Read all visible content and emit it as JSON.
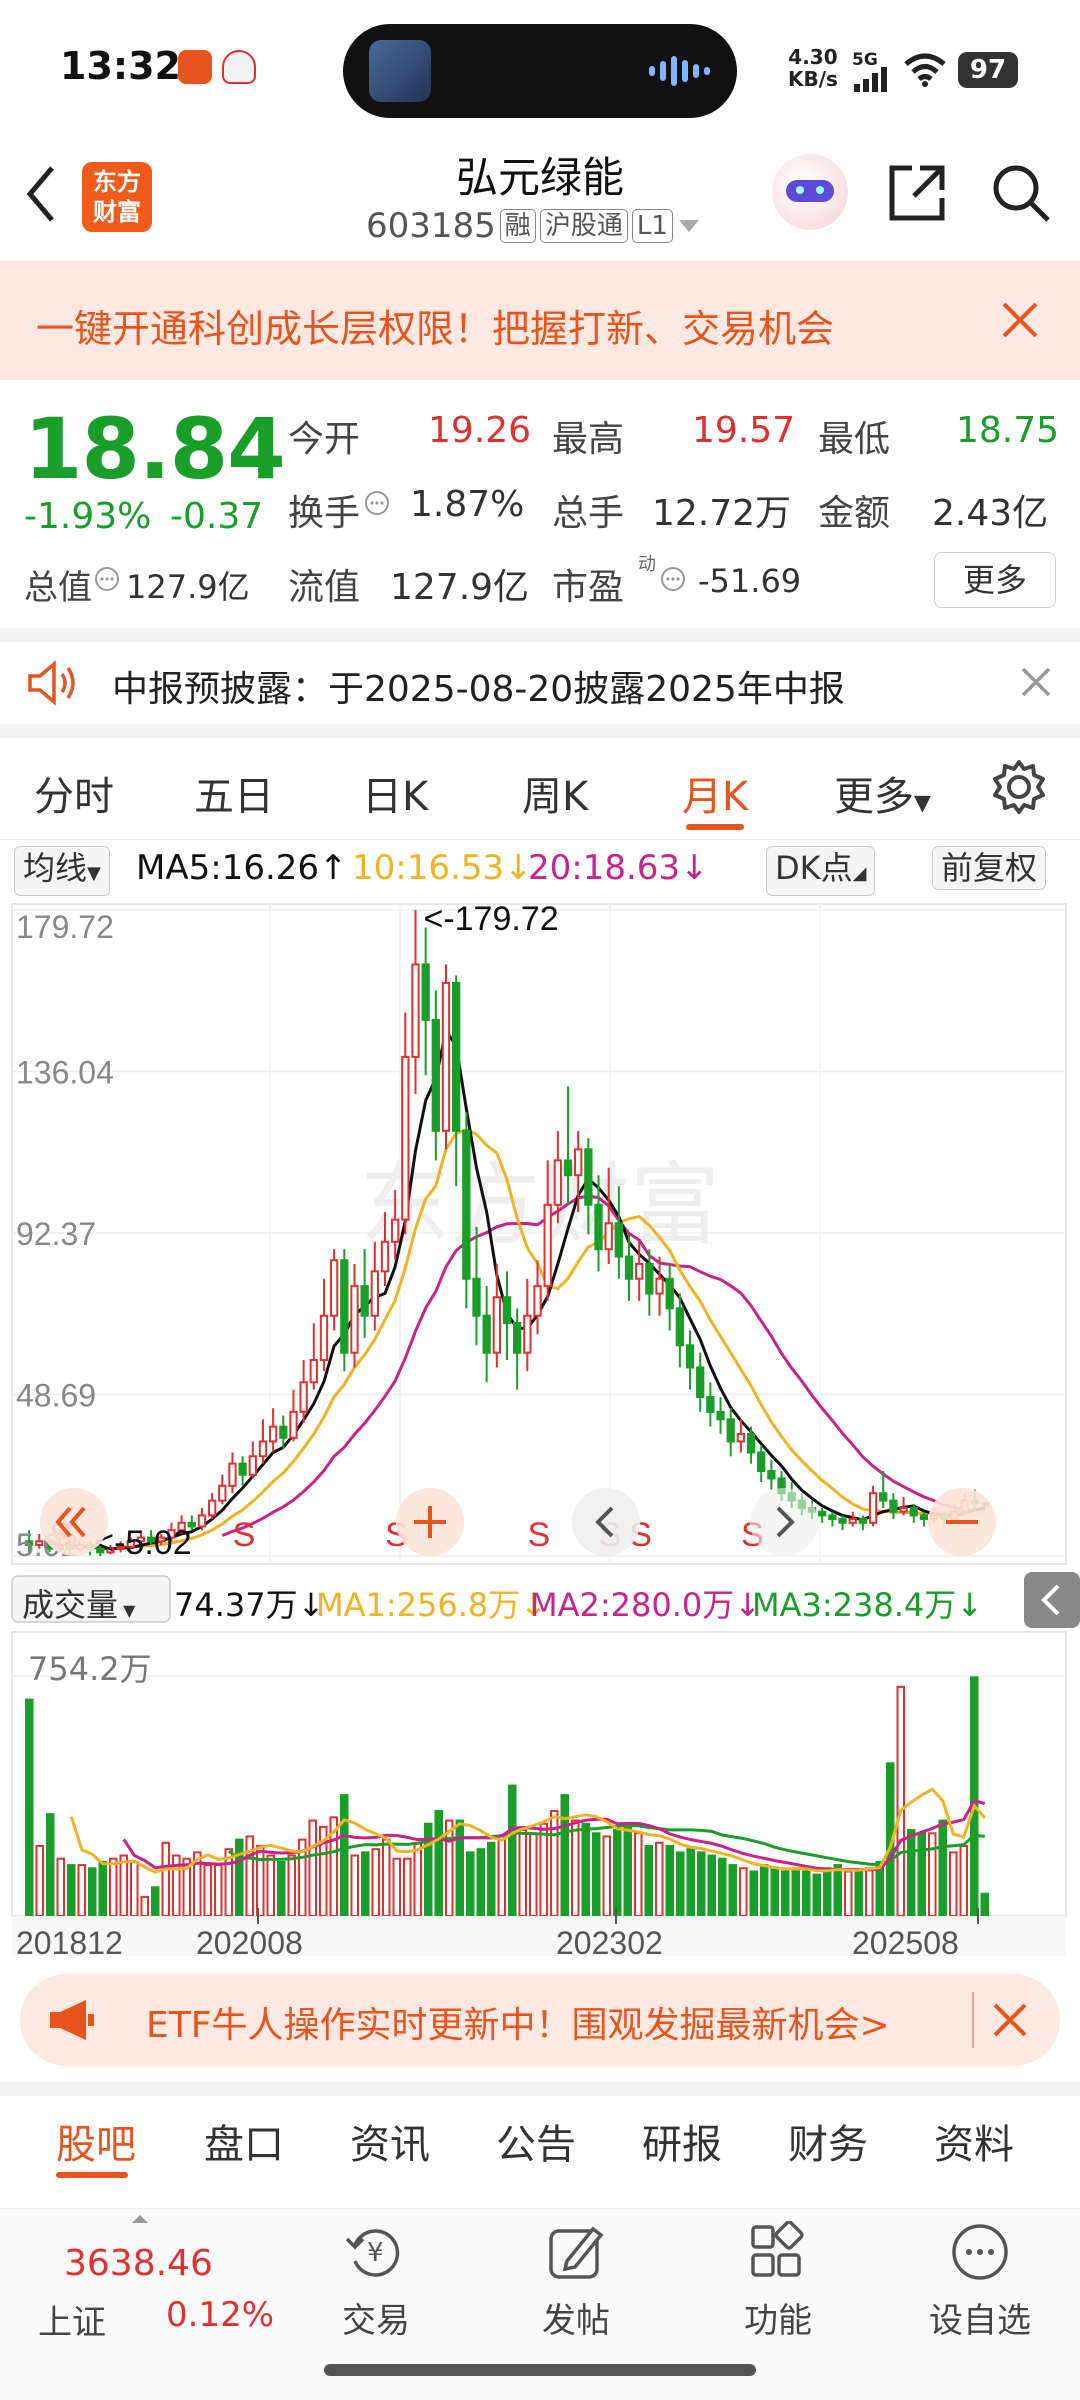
{
  "status_bar": {
    "time": "13:32",
    "net_speed_value": "4.30",
    "net_speed_unit": "KB/s",
    "network": "5G",
    "battery": "97"
  },
  "header": {
    "logo_line1": "东方",
    "logo_line2": "财富",
    "stock_name": "弘元绿能",
    "stock_code": "603185",
    "tags": [
      "融",
      "沪股通",
      "L1"
    ]
  },
  "banner": {
    "text": "一键开通科创成长层权限！把握打新、交易机会"
  },
  "quote": {
    "price": "18.84",
    "change_pct": "-1.93%",
    "change": "-0.37",
    "open_label": "今开",
    "open": "19.26",
    "high_label": "最高",
    "high": "19.57",
    "low_label": "最低",
    "low": "18.75",
    "turnover_label": "换手",
    "turnover": "1.87%",
    "volume_label": "总手",
    "volume": "12.72万",
    "amount_label": "金额",
    "amount": "2.43亿",
    "mktcap_label": "总值",
    "mktcap": "127.9亿",
    "float_label": "流值",
    "float": "127.9亿",
    "pe_label": "市盈",
    "pe_sup": "动",
    "pe": "-51.69",
    "more_label": "更多"
  },
  "notice": {
    "text": "中报预披露：于2025-08-20披露2025年中报"
  },
  "kline_tabs": [
    "分时",
    "五日",
    "日K",
    "周K",
    "月K",
    "更多"
  ],
  "kline_active": "月K",
  "ma_row": {
    "selector": "均线",
    "ma5": "MA5:16.26",
    "ma5_arrow": "↑",
    "ma10": "10:16.53",
    "ma10_arrow": "↓",
    "ma20": "20:18.63",
    "ma20_arrow": "↓",
    "dk_label": "DK点",
    "adjust_label": "前复权"
  },
  "chart_data": {
    "type": "candlestick",
    "period": "monthly",
    "y_ticks": [
      "179.72",
      "136.04",
      "92.37",
      "48.69",
      "5.02"
    ],
    "ylim": [
      5.02,
      179.72
    ],
    "max_annotation": "<-179.72",
    "min_annotation": "<-5.02",
    "x_ticks": [
      "201812",
      "202008",
      "202302",
      "202508"
    ],
    "signal_marker": "S",
    "candles": [
      {
        "o": 9,
        "c": 8,
        "h": 12,
        "l": 6
      },
      {
        "o": 8,
        "c": 9,
        "h": 11,
        "l": 7
      },
      {
        "o": 9,
        "c": 7,
        "h": 10,
        "l": 6
      },
      {
        "o": 7,
        "c": 8,
        "h": 10,
        "l": 6
      },
      {
        "o": 8,
        "c": 7,
        "h": 9,
        "l": 5.5
      },
      {
        "o": 7,
        "c": 8,
        "h": 9,
        "l": 6
      },
      {
        "o": 8,
        "c": 7,
        "h": 9,
        "l": 5.2
      },
      {
        "o": 7,
        "c": 6,
        "h": 8,
        "l": 5.02
      },
      {
        "o": 6,
        "c": 7,
        "h": 8,
        "l": 5.5
      },
      {
        "o": 7,
        "c": 7.5,
        "h": 9,
        "l": 6
      },
      {
        "o": 7.5,
        "c": 9,
        "h": 10,
        "l": 7
      },
      {
        "o": 9,
        "c": 10,
        "h": 12,
        "l": 8
      },
      {
        "o": 10,
        "c": 9,
        "h": 12,
        "l": 8
      },
      {
        "o": 9,
        "c": 10,
        "h": 11,
        "l": 8
      },
      {
        "o": 10,
        "c": 12,
        "h": 14,
        "l": 9
      },
      {
        "o": 12,
        "c": 14,
        "h": 16,
        "l": 11
      },
      {
        "o": 14,
        "c": 13,
        "h": 16,
        "l": 12
      },
      {
        "o": 13,
        "c": 16,
        "h": 18,
        "l": 12
      },
      {
        "o": 16,
        "c": 20,
        "h": 22,
        "l": 15
      },
      {
        "o": 20,
        "c": 24,
        "h": 27,
        "l": 19
      },
      {
        "o": 24,
        "c": 30,
        "h": 33,
        "l": 22
      },
      {
        "o": 30,
        "c": 27,
        "h": 32,
        "l": 24
      },
      {
        "o": 27,
        "c": 32,
        "h": 36,
        "l": 26
      },
      {
        "o": 32,
        "c": 36,
        "h": 42,
        "l": 30
      },
      {
        "o": 36,
        "c": 40,
        "h": 45,
        "l": 33
      },
      {
        "o": 40,
        "c": 37,
        "h": 43,
        "l": 34
      },
      {
        "o": 37,
        "c": 44,
        "h": 50,
        "l": 36
      },
      {
        "o": 44,
        "c": 52,
        "h": 58,
        "l": 41
      },
      {
        "o": 52,
        "c": 58,
        "h": 68,
        "l": 50
      },
      {
        "o": 58,
        "c": 70,
        "h": 80,
        "l": 55
      },
      {
        "o": 70,
        "c": 85,
        "h": 88,
        "l": 66
      },
      {
        "o": 85,
        "c": 60,
        "h": 88,
        "l": 55
      },
      {
        "o": 60,
        "c": 78,
        "h": 84,
        "l": 56
      },
      {
        "o": 78,
        "c": 70,
        "h": 88,
        "l": 64
      },
      {
        "o": 70,
        "c": 82,
        "h": 90,
        "l": 66
      },
      {
        "o": 82,
        "c": 90,
        "h": 98,
        "l": 78
      },
      {
        "o": 90,
        "c": 96,
        "h": 104,
        "l": 85
      },
      {
        "o": 96,
        "c": 140,
        "h": 152,
        "l": 92
      },
      {
        "o": 140,
        "c": 165,
        "h": 179.72,
        "l": 130
      },
      {
        "o": 165,
        "c": 150,
        "h": 175,
        "l": 135
      },
      {
        "o": 150,
        "c": 120,
        "h": 158,
        "l": 112
      },
      {
        "o": 120,
        "c": 160,
        "h": 165,
        "l": 115
      },
      {
        "o": 160,
        "c": 120,
        "h": 162,
        "l": 105
      },
      {
        "o": 120,
        "c": 80,
        "h": 125,
        "l": 72
      },
      {
        "o": 80,
        "c": 70,
        "h": 94,
        "l": 62
      },
      {
        "o": 70,
        "c": 60,
        "h": 78,
        "l": 52
      },
      {
        "o": 60,
        "c": 75,
        "h": 84,
        "l": 56
      },
      {
        "o": 75,
        "c": 68,
        "h": 82,
        "l": 58
      },
      {
        "o": 68,
        "c": 60,
        "h": 72,
        "l": 50
      },
      {
        "o": 60,
        "c": 70,
        "h": 80,
        "l": 55
      },
      {
        "o": 70,
        "c": 78,
        "h": 85,
        "l": 65
      },
      {
        "o": 78,
        "c": 100,
        "h": 112,
        "l": 74
      },
      {
        "o": 100,
        "c": 112,
        "h": 120,
        "l": 95
      },
      {
        "o": 112,
        "c": 108,
        "h": 132,
        "l": 100
      },
      {
        "o": 108,
        "c": 115,
        "h": 120,
        "l": 98
      },
      {
        "o": 115,
        "c": 100,
        "h": 118,
        "l": 92
      },
      {
        "o": 100,
        "c": 88,
        "h": 108,
        "l": 82
      },
      {
        "o": 88,
        "c": 95,
        "h": 110,
        "l": 84
      },
      {
        "o": 95,
        "c": 86,
        "h": 105,
        "l": 80
      },
      {
        "o": 86,
        "c": 80,
        "h": 92,
        "l": 74
      },
      {
        "o": 80,
        "c": 84,
        "h": 90,
        "l": 74
      },
      {
        "o": 84,
        "c": 76,
        "h": 88,
        "l": 70
      },
      {
        "o": 76,
        "c": 80,
        "h": 86,
        "l": 70
      },
      {
        "o": 80,
        "c": 72,
        "h": 84,
        "l": 66
      },
      {
        "o": 72,
        "c": 62,
        "h": 76,
        "l": 56
      },
      {
        "o": 62,
        "c": 56,
        "h": 66,
        "l": 50
      },
      {
        "o": 56,
        "c": 48,
        "h": 60,
        "l": 44
      },
      {
        "o": 48,
        "c": 44,
        "h": 52,
        "l": 40
      },
      {
        "o": 44,
        "c": 42,
        "h": 48,
        "l": 38
      },
      {
        "o": 42,
        "c": 36,
        "h": 45,
        "l": 32
      },
      {
        "o": 36,
        "c": 38,
        "h": 42,
        "l": 33
      },
      {
        "o": 38,
        "c": 33,
        "h": 40,
        "l": 30
      },
      {
        "o": 33,
        "c": 28,
        "h": 35,
        "l": 25
      },
      {
        "o": 28,
        "c": 26,
        "h": 31,
        "l": 23
      },
      {
        "o": 26,
        "c": 22,
        "h": 28,
        "l": 20
      },
      {
        "o": 22,
        "c": 20,
        "h": 25,
        "l": 18
      },
      {
        "o": 20,
        "c": 18,
        "h": 22,
        "l": 16
      },
      {
        "o": 18,
        "c": 17,
        "h": 20,
        "l": 15
      },
      {
        "o": 17,
        "c": 16,
        "h": 18,
        "l": 14
      },
      {
        "o": 16,
        "c": 15,
        "h": 17,
        "l": 13
      },
      {
        "o": 15,
        "c": 14,
        "h": 16,
        "l": 12
      },
      {
        "o": 14,
        "c": 15,
        "h": 17,
        "l": 13
      },
      {
        "o": 15,
        "c": 14,
        "h": 16,
        "l": 12
      },
      {
        "o": 14,
        "c": 22,
        "h": 24,
        "l": 13
      },
      {
        "o": 22,
        "c": 20,
        "h": 28,
        "l": 18
      },
      {
        "o": 20,
        "c": 17,
        "h": 22,
        "l": 15
      },
      {
        "o": 17,
        "c": 18,
        "h": 21,
        "l": 16
      },
      {
        "o": 18,
        "c": 16,
        "h": 19,
        "l": 14
      },
      {
        "o": 16,
        "c": 15,
        "h": 17,
        "l": 13
      },
      {
        "o": 15,
        "c": 16,
        "h": 18,
        "l": 14
      },
      {
        "o": 16,
        "c": 15,
        "h": 17,
        "l": 13
      },
      {
        "o": 15,
        "c": 17,
        "h": 19,
        "l": 14
      },
      {
        "o": 17,
        "c": 20,
        "h": 22,
        "l": 16
      },
      {
        "o": 20,
        "c": 19.26,
        "h": 23,
        "l": 17
      },
      {
        "o": 19.26,
        "c": 18.84,
        "h": 19.57,
        "l": 18.75
      }
    ],
    "signals": [
      3,
      21,
      36,
      50,
      57,
      60,
      71
    ]
  },
  "volume_row": {
    "selector": "成交量",
    "vol": "74.37万",
    "vol_arrow": "↓",
    "ma1": "MA1:256.8万",
    "ma1_arrow": "↓",
    "ma2": "MA2:280.0万",
    "ma2_arrow": "↓",
    "ma3": "MA3:238.4万",
    "ma3_arrow": "↓",
    "max_label": "754.2万"
  },
  "volume_data": {
    "ylim": [
      0,
      754.2
    ],
    "values": [
      680,
      220,
      320,
      180,
      160,
      160,
      150,
      170,
      180,
      190,
      170,
      60,
      90,
      230,
      190,
      180,
      200,
      160,
      160,
      210,
      240,
      250,
      220,
      190,
      170,
      190,
      240,
      300,
      280,
      310,
      380,
      190,
      200,
      210,
      240,
      180,
      180,
      230,
      290,
      330,
      300,
      300,
      200,
      210,
      230,
      250,
      410,
      270,
      260,
      290,
      330,
      380,
      300,
      290,
      260,
      250,
      270,
      280,
      260,
      220,
      230,
      220,
      200,
      210,
      200,
      190,
      180,
      160,
      150,
      140,
      160,
      150,
      140,
      150,
      140,
      130,
      150,
      160,
      140,
      140,
      150,
      170,
      480,
      720,
      270,
      260,
      260,
      300,
      200,
      220,
      750,
      70
    ]
  },
  "etf_banner": {
    "text": "ETF牛人操作实时更新中！围观发掘最新机会>"
  },
  "bottom_tabs": [
    "股吧",
    "盘口",
    "资讯",
    "公告",
    "研报",
    "财务",
    "资料"
  ],
  "bottom_tab_active": "股吧",
  "bottom_nav": {
    "index_value": "3638.46",
    "index_name": "上证",
    "index_change": "0.12%",
    "items": [
      "交易",
      "发帖",
      "功能",
      "设自选"
    ]
  },
  "colors": {
    "up": "#e03030",
    "down": "#1a9e2a",
    "accent": "#e8541e",
    "ma5": "#111111",
    "ma10": "#f0b323",
    "ma20": "#c8238a"
  }
}
